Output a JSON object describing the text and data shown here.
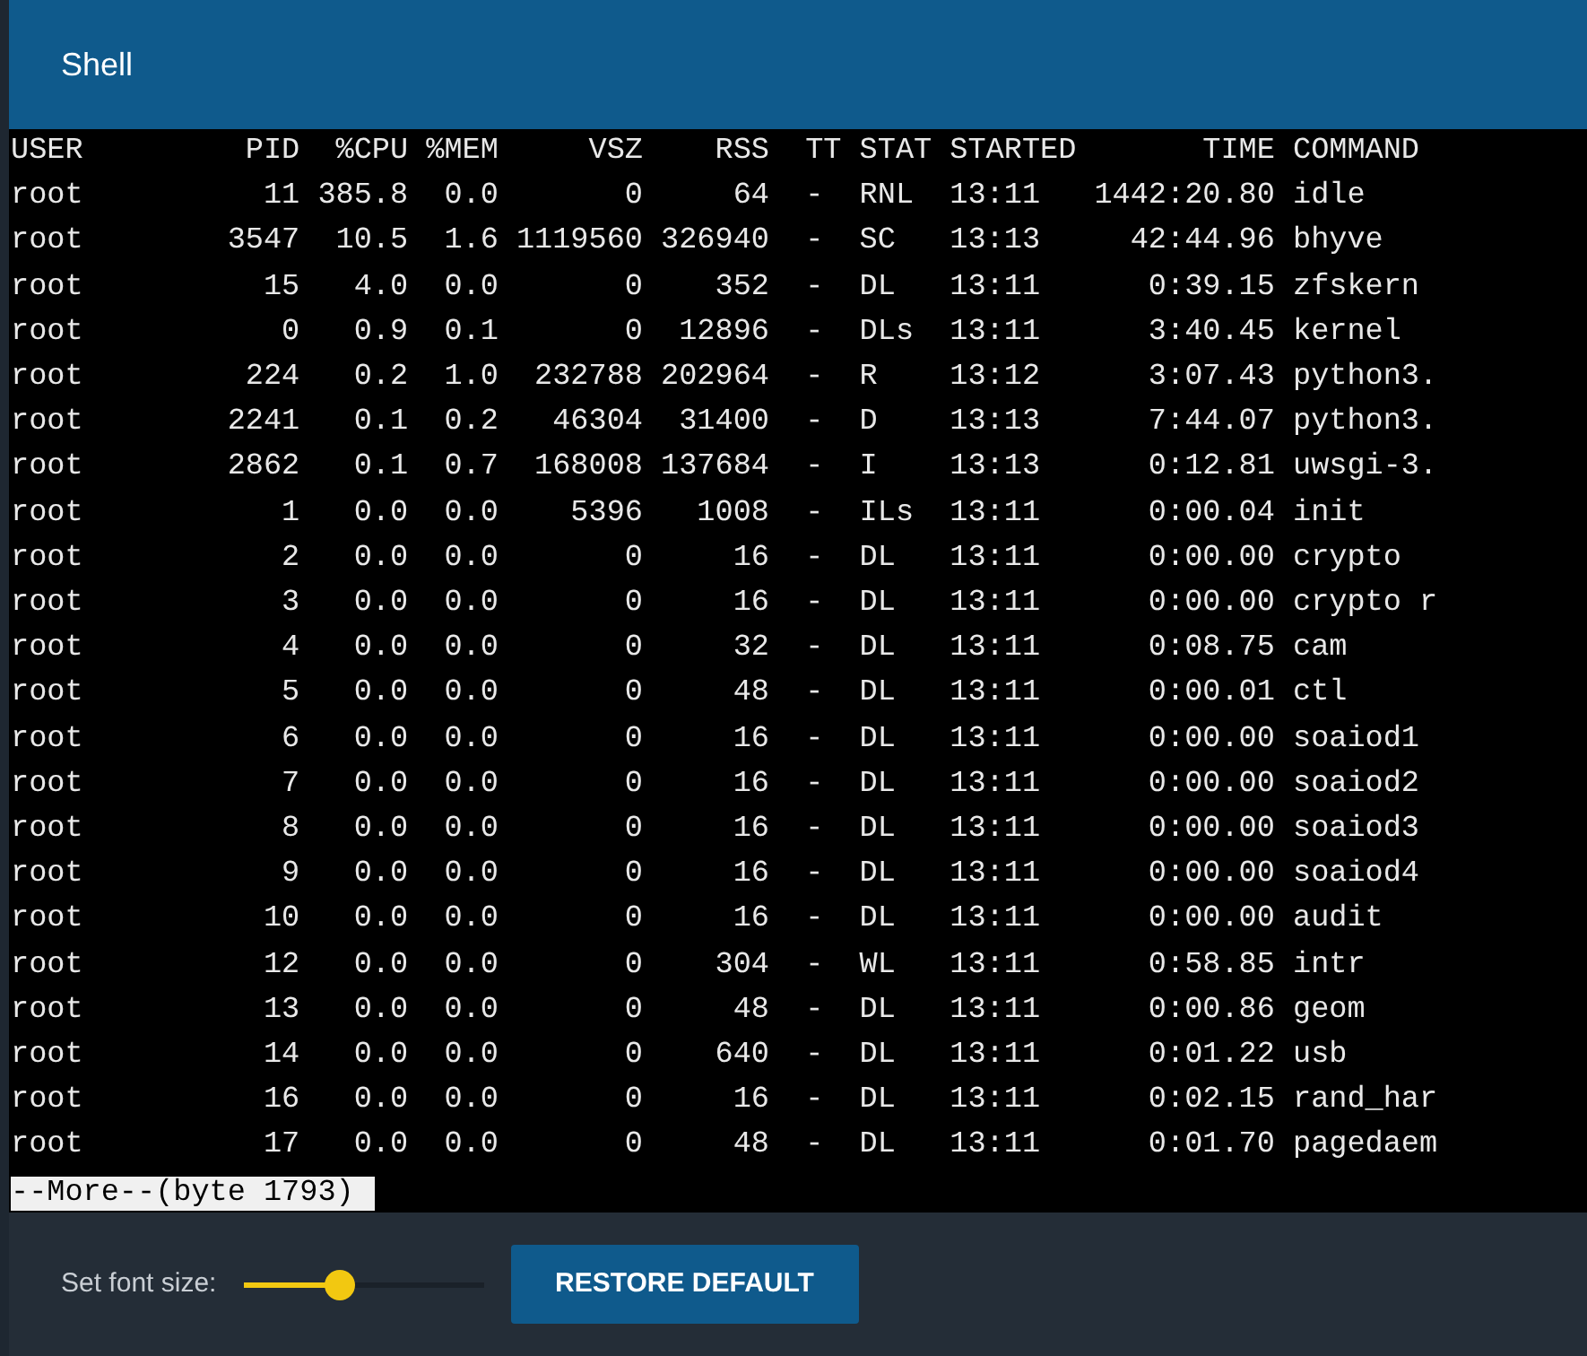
{
  "header": {
    "title": "Shell"
  },
  "terminal": {
    "lines": [
      "USER         PID  %CPU %MEM     VSZ    RSS  TT STAT STARTED       TIME COMMAND",
      "root          11 385.8  0.0       0     64  -  RNL  13:11   1442:20.80 idle",
      "root        3547  10.5  1.6 1119560 326940  -  SC   13:13     42:44.96 bhyve",
      "root          15   4.0  0.0       0    352  -  DL   13:11      0:39.15 zfskern",
      "root           0   0.9  0.1       0  12896  -  DLs  13:11      3:40.45 kernel",
      "root         224   0.2  1.0  232788 202964  -  R    13:12      3:07.43 python3.",
      "root        2241   0.1  0.2   46304  31400  -  D    13:13      7:44.07 python3.",
      "root        2862   0.1  0.7  168008 137684  -  I    13:13      0:12.81 uwsgi-3.",
      "root           1   0.0  0.0    5396   1008  -  ILs  13:11      0:00.04 init",
      "root           2   0.0  0.0       0     16  -  DL   13:11      0:00.00 crypto",
      "root           3   0.0  0.0       0     16  -  DL   13:11      0:00.00 crypto r",
      "root           4   0.0  0.0       0     32  -  DL   13:11      0:08.75 cam",
      "root           5   0.0  0.0       0     48  -  DL   13:11      0:00.01 ctl",
      "root           6   0.0  0.0       0     16  -  DL   13:11      0:00.00 soaiod1",
      "root           7   0.0  0.0       0     16  -  DL   13:11      0:00.00 soaiod2",
      "root           8   0.0  0.0       0     16  -  DL   13:11      0:00.00 soaiod3",
      "root           9   0.0  0.0       0     16  -  DL   13:11      0:00.00 soaiod4",
      "root          10   0.0  0.0       0     16  -  DL   13:11      0:00.00 audit",
      "root          12   0.0  0.0       0    304  -  WL   13:11      0:58.85 intr",
      "root          13   0.0  0.0       0     48  -  DL   13:11      0:00.86 geom",
      "root          14   0.0  0.0       0    640  -  DL   13:11      0:01.22 usb",
      "root          16   0.0  0.0       0     16  -  DL   13:11      0:02.15 rand_har",
      "root          17   0.0  0.0       0     48  -  DL   13:11      0:01.70 pagedaem"
    ],
    "prompt": "--More--(byte 1793)"
  },
  "footer": {
    "font_size_label": "Set font size:",
    "font_size_slider": {
      "level": 0.4
    },
    "restore_button": "RESTORE DEFAULT"
  }
}
